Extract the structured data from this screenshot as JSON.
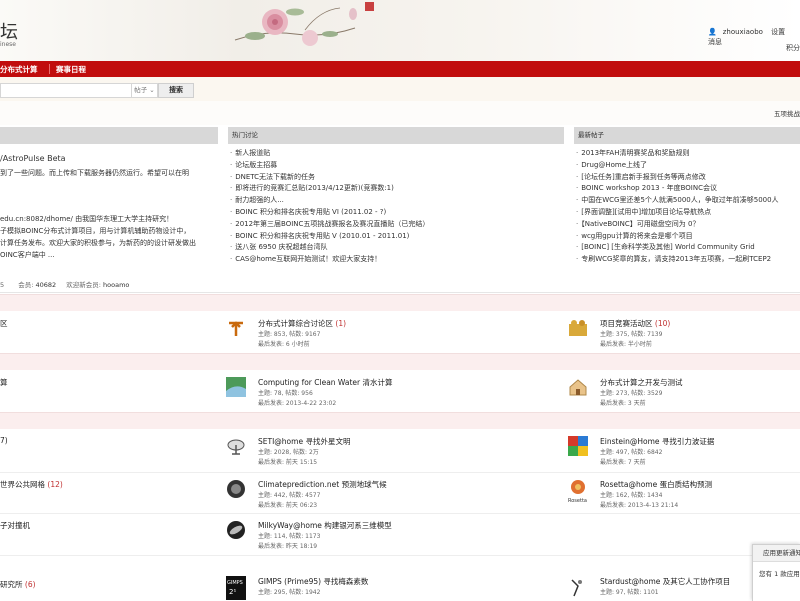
{
  "header": {
    "logo_text": "坛",
    "logo_sub": "inese",
    "user_links": [
      "zhouxiaobo",
      "设置",
      "消息"
    ],
    "jifen": "积分"
  },
  "nav": {
    "items": [
      "分布式计算",
      "赛事日程"
    ]
  },
  "search": {
    "type_label": "帖子 ⌄",
    "button": "搜索"
  },
  "strip": {
    "right_text": "五项挑战"
  },
  "top_section": {
    "left_title": "/AstroPulse Beta",
    "left_lines": [
      "到了一些问题。而上传和下载服务器仍然运行。希望可以在明",
      ""
    ],
    "left_lines2": [
      "edu.cn:8082/dhome/ 由我国华东理工大学主持研究！",
      "子模拟BOINC分布式计算项目，用与计算机辅助药物设计中，",
      "计算任务发布。欢迎大家的积极参与，为新药的的设计研发做出",
      "OINC客户端中 ..."
    ],
    "hot_title": "热门讨论",
    "hot": [
      "新人报道贴",
      "论坛版主招募",
      "DNETC无法下载新的任务",
      "即将进行的竞赛汇总贴(2013/4/12更新)(竞赛数:1)",
      "耐力超强的人...",
      "BOINC 积分和排名庆祝专用贴 VI (2011.02 - ?)",
      "2012年第三届BOINC五项挑战赛报名及赛况直播贴（已完结）",
      "BOINC 积分和排名庆祝专用贴 V (2010.01 - 2011.01)",
      "送八张 6950 庆祝超越台湾队",
      "CAS@home互联网开始测试！欢迎大家支持！"
    ],
    "new_title": "最新帖子",
    "new": [
      "2013年FAH清明赛奖品和奖励规则",
      "Drug@Home上线了",
      "[论坛任务]重启新手报到任务等两点修改",
      "BOINC workshop 2013 - 年度BOINC会议",
      "中国在WCG里还差5个人就满5000人，争取过年前凑够5000人",
      "[界面调整][试用中]增加项目论坛导航热点",
      "【NativeBOINC】可用磁盘空间为 0？",
      "wcg用gpu计算的将来会是哪个项目",
      "[BOINC] [生命科学类及其他] World Community Grid",
      "专刷WCG奖章的算友，请支持2013年五项赛，一起刷TCEP2"
    ]
  },
  "stats": {
    "members_label": "会员:",
    "members": "40682",
    "newest_label": "欢迎新会员:",
    "newest": "hooamo",
    "prefix": "5"
  },
  "forums": {
    "row1": {
      "left": "区",
      "mid_title": "分布式计算综合讨论区",
      "mid_cnt": "(1)",
      "mid_meta1": "主题: 853, 帖数: 9167",
      "mid_meta2": "最后发表: 6 小时前",
      "right_title": "项目竞赛活动区",
      "right_cnt": "(10)",
      "right_meta1": "主题: 375, 帖数: 7139",
      "right_meta2": "最后发表: 半小时前"
    },
    "row2": {
      "left": "算",
      "mid_title": "Computing for Clean Water 清水计算",
      "mid_meta1": "主题: 78, 帖数: 956",
      "mid_meta2": "最后发表: 2013-4-22 23:02",
      "right_title": "分布式计算之开发与测试",
      "right_meta1": "主题: 273, 帖数: 3529",
      "right_meta2": "最后发表: 3 天前"
    },
    "row3": {
      "left": "7)",
      "mid_title": "SETI@home 寻找外星文明",
      "mid_meta1": "主题: 2028, 帖数: 2万",
      "mid_meta2": "最后发表: 前天 15:15",
      "right_title": "Einstein@Home 寻找引力波证据",
      "right_meta1": "主题: 497, 帖数: 6842",
      "right_meta2": "最后发表: 7 天前"
    },
    "row4": {
      "left": "世界公共网格",
      "left_cnt": "(12)",
      "mid_title": "Climateprediction.net 预测地球气候",
      "mid_meta1": "主题: 442, 帖数: 4577",
      "mid_meta2": "最后发表: 前天 06:23",
      "right_title": "Rosetta@home 蛋白质结构预测",
      "right_meta1": "主题: 162, 帖数: 1434",
      "right_meta2": "最后发表: 2013-4-13 21:14"
    },
    "row5": {
      "left": "子对撞机",
      "mid_title": "MilkyWay@home 构建银河系三维模型",
      "mid_meta1": "主题: 114, 帖数: 1173",
      "mid_meta2": "最后发表: 昨天 18:19"
    },
    "row6": {
      "left": "研究所",
      "left_cnt": "(6)",
      "mid_title": "GIMPS (Prime95) 寻找梅森素数",
      "mid_meta1": "主题: 295, 帖数: 1942",
      "right_title": "Stardust@home 及其它人工协作项目",
      "right_meta1": "主题: 97, 帖数: 1101"
    }
  },
  "popup": {
    "title": "应用更新通知",
    "body": "您有 1 款应用更新"
  },
  "colors": {
    "nav_red": "#c10d0d",
    "count_red": "#c03030"
  }
}
